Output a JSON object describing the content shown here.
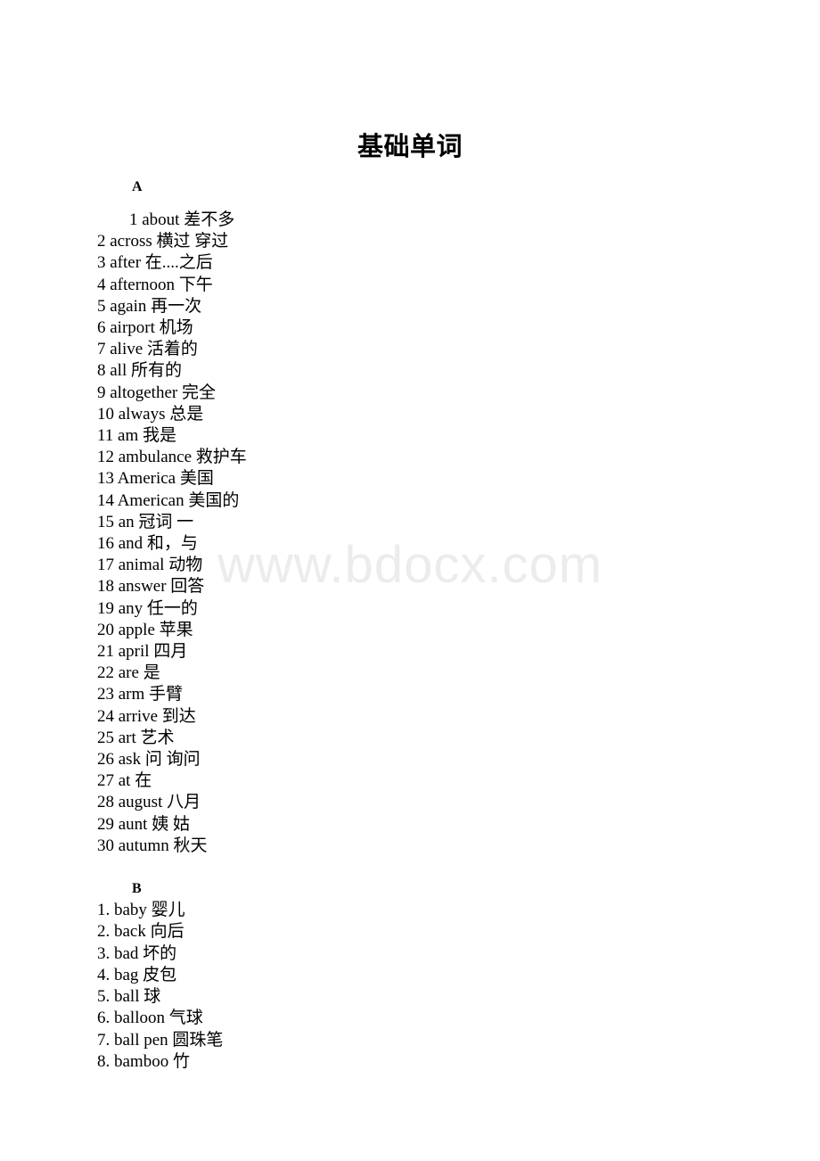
{
  "document": {
    "title": "基础单词",
    "watermark": "www.bdocx.com",
    "sections": [
      {
        "heading": "A",
        "entries": [
          "1 about 差不多",
          "2 across 横过 穿过",
          "3 after 在....之后",
          "4 afternoon 下午",
          "5 again 再一次",
          "6 airport 机场",
          "7 alive 活着的",
          "8 all 所有的",
          "9 altogether 完全",
          "10 always 总是",
          "11 am 我是",
          "12 ambulance 救护车",
          "13 America 美国",
          "14 American 美国的",
          "15 an 冠词 一",
          "16 and 和，与",
          "17 animal 动物",
          "18 answer 回答",
          "19 any 任一的",
          "20 apple 苹果",
          "21 april 四月",
          "22 are 是",
          "23 arm 手臂",
          "24 arrive 到达",
          "25 art 艺术",
          "26 ask 问 询问",
          "27 at 在",
          "28 august 八月",
          "29 aunt 姨 姑",
          "30 autumn 秋天"
        ]
      },
      {
        "heading": "B",
        "entries": [
          "1. baby 婴儿",
          "2. back 向后",
          "3. bad 坏的",
          "4. bag 皮包",
          "5. ball 球",
          "6. balloon 气球",
          "7. ball pen 圆珠笔",
          "8. bamboo 竹"
        ]
      }
    ]
  }
}
